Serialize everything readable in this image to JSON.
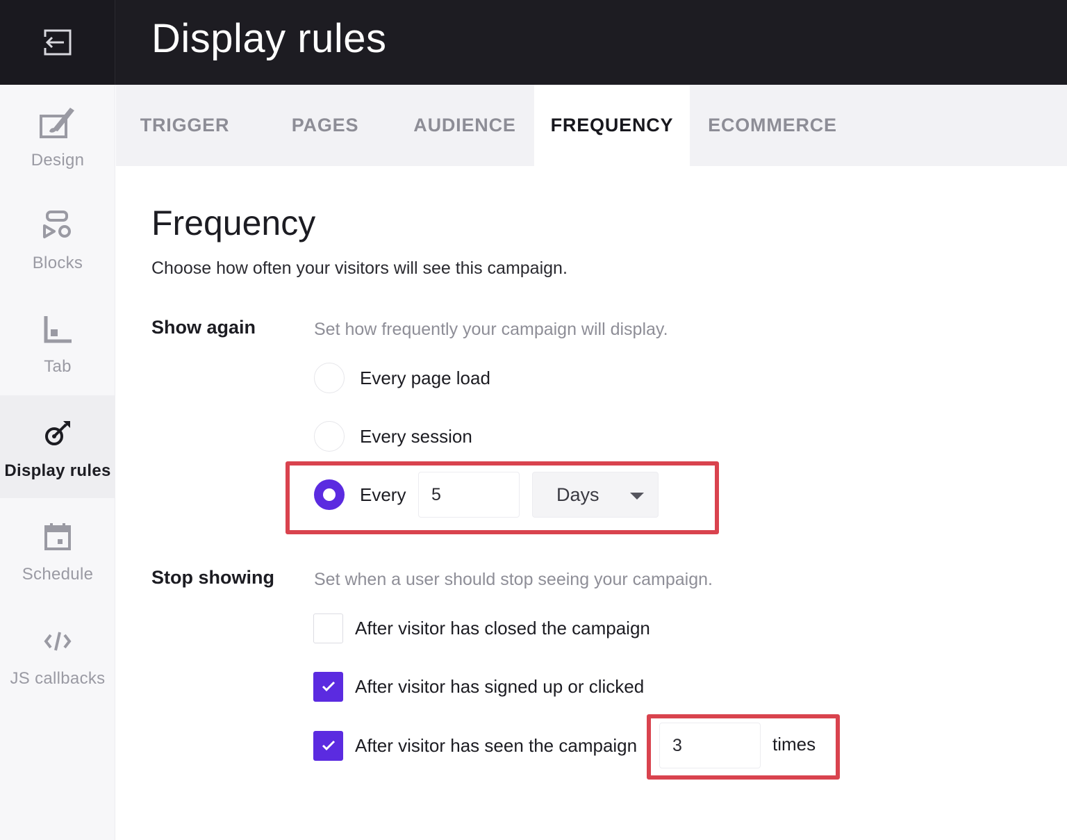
{
  "header": {
    "title": "Display rules",
    "exit_icon": "exit-icon"
  },
  "sidebar": {
    "items": [
      {
        "label": "Design",
        "icon": "design-brush-icon"
      },
      {
        "label": "Blocks",
        "icon": "blocks-icon"
      },
      {
        "label": "Tab",
        "icon": "tab-icon"
      },
      {
        "label": "Display rules",
        "icon": "display-rules-icon"
      },
      {
        "label": "Schedule",
        "icon": "calendar-icon"
      },
      {
        "label": "JS callbacks",
        "icon": "code-icon"
      }
    ],
    "active": "Display rules"
  },
  "tabs": {
    "items": [
      {
        "label": "TRIGGER"
      },
      {
        "label": "PAGES"
      },
      {
        "label": "AUDIENCE"
      },
      {
        "label": "FREQUENCY"
      },
      {
        "label": "ECOMMERCE"
      }
    ],
    "active": "FREQUENCY"
  },
  "content": {
    "title": "Frequency",
    "subtitle": "Choose how often your visitors will see this campaign.",
    "show_again": {
      "label": "Show again",
      "help": "Set how frequently your campaign will display.",
      "options": [
        {
          "label": "Every page load",
          "checked": false
        },
        {
          "label": "Every session",
          "checked": false
        },
        {
          "label": "Every",
          "checked": true
        }
      ],
      "interval_value": "5",
      "interval_unit": "Days"
    },
    "stop_showing": {
      "label": "Stop showing",
      "help": "Set when a user should stop seeing your campaign.",
      "options": [
        {
          "label": "After visitor has closed the campaign",
          "checked": false
        },
        {
          "label": "After visitor has signed up or clicked",
          "checked": true
        },
        {
          "label": "After visitor has seen the campaign",
          "checked": true
        }
      ],
      "seen_count": "3",
      "seen_suffix": "times"
    }
  },
  "colors": {
    "accent": "#5b2be0",
    "highlight": "#d9434e",
    "header_bg": "#1d1c22"
  }
}
